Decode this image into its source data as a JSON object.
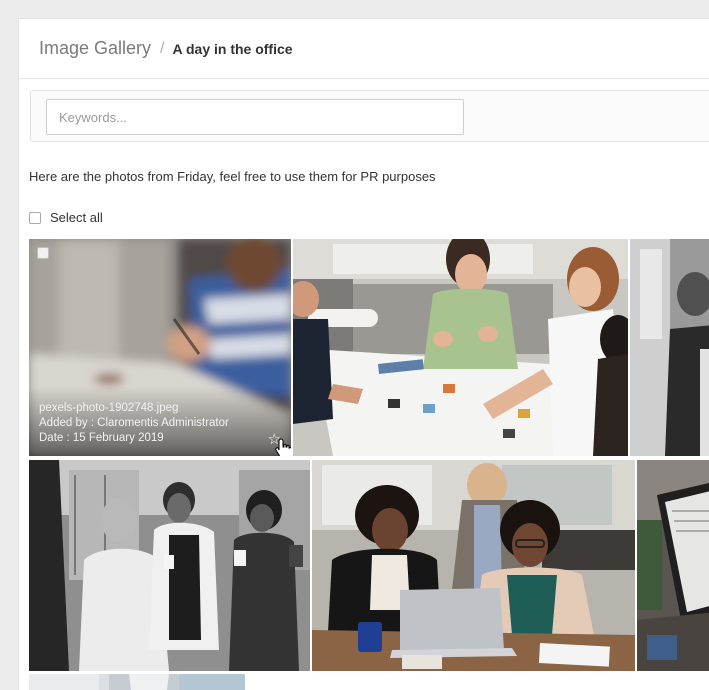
{
  "breadcrumb": {
    "root": "Image Gallery",
    "separator": "/",
    "current": "A day in the office"
  },
  "search": {
    "placeholder": "Keywords...",
    "value": ""
  },
  "description": "Here are the photos from Friday, feel free to use them for PR purposes",
  "select_all": {
    "label": "Select all",
    "checked": false
  },
  "photos": [
    {
      "filename": "pexels-photo-1902748.jpeg",
      "added_by": "Added by : Claromentis Administrator",
      "date": "Date : 15 February 2019",
      "hovered": true
    }
  ],
  "icons": {
    "favorite": "star-outline-icon",
    "checkbox": "checkbox-icon"
  },
  "colors": {
    "panel_bg": "#ffffff",
    "page_bg": "#ececec",
    "border": "#e2e2e2"
  }
}
